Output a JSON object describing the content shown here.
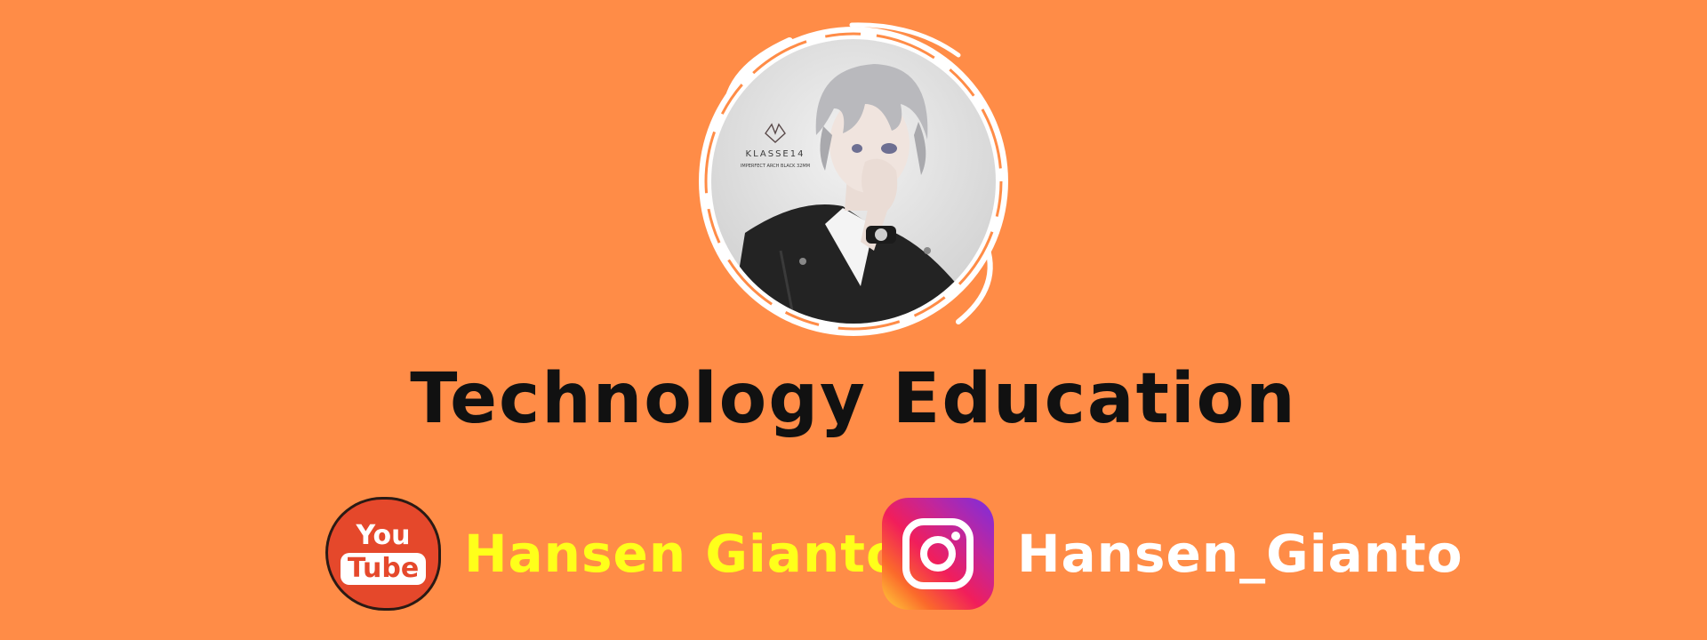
{
  "background_color": "#ff8c47",
  "avatar": {
    "logo_text": "KLASSE14",
    "logo_subtext": "IMPERFECT ARCH BLACK 32MM"
  },
  "title": "Technology Education",
  "socials": [
    {
      "platform": "youtube",
      "icon": "youtube-icon",
      "icon_text_top": "You",
      "icon_text_bottom": "Tube",
      "handle": "Hansen Gianto",
      "color": "#ffff1a"
    },
    {
      "platform": "instagram",
      "icon": "instagram-icon",
      "handle": "Hansen_Gianto",
      "color": "#ffffff"
    }
  ]
}
